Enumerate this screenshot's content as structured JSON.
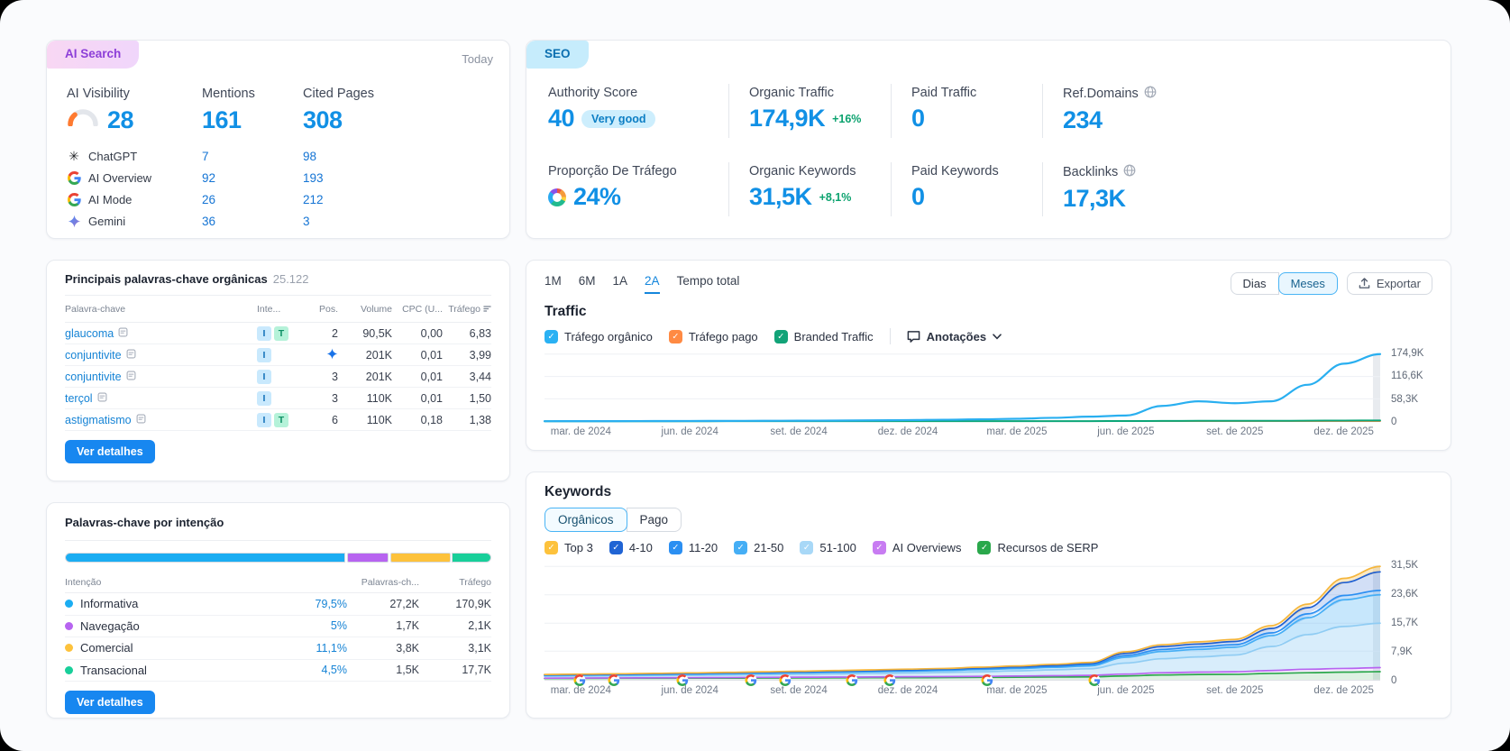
{
  "ai_search": {
    "tab": "AI Search",
    "date": "Today",
    "stats": [
      {
        "label": "AI Visibility",
        "value": "28"
      },
      {
        "label": "Mentions",
        "value": "161"
      },
      {
        "label": "Cited Pages",
        "value": "308"
      }
    ],
    "engines": [
      {
        "name": "ChatGPT",
        "icon": "chatgpt-icon",
        "mentions": "7",
        "cited": "98"
      },
      {
        "name": "AI Overview",
        "icon": "google-icon",
        "mentions": "92",
        "cited": "193"
      },
      {
        "name": "AI Mode",
        "icon": "google-icon",
        "mentions": "26",
        "cited": "212"
      },
      {
        "name": "Gemini",
        "icon": "gemini-icon",
        "mentions": "36",
        "cited": "3"
      }
    ]
  },
  "seo": {
    "tab": "SEO",
    "cells": [
      {
        "label": "Authority Score",
        "value": "40",
        "badge": "Very good"
      },
      {
        "label": "Organic Traffic",
        "value": "174,9K",
        "delta": "+16%"
      },
      {
        "label": "Paid Traffic",
        "value": "0"
      },
      {
        "label": "Ref.Domains",
        "value": "234",
        "icon": "globe-icon"
      },
      {
        "label": "Proporção De Tráfego",
        "value": "24%",
        "icon": "donut-icon"
      },
      {
        "label": "Organic Keywords",
        "value": "31,5K",
        "delta": "+8,1%"
      },
      {
        "label": "Paid Keywords",
        "value": "0"
      },
      {
        "label": "Backlinks",
        "value": "17,3K",
        "icon": "globe-icon"
      }
    ]
  },
  "top_keywords": {
    "title": "Principais palavras-chave orgânicas",
    "count": "25.122",
    "columns": [
      "Palavra-chave",
      "Inte...",
      "Pos.",
      "Volume",
      "CPC (U...",
      "Tráfego"
    ],
    "rows": [
      {
        "keyword": "glaucoma",
        "intents": [
          "I",
          "T"
        ],
        "pos": "2",
        "pos_is_icon": false,
        "volume": "90,5K",
        "cpc": "0,00",
        "traffic": "6,83"
      },
      {
        "keyword": "conjuntivite",
        "intents": [
          "I"
        ],
        "pos": "AI",
        "pos_is_icon": true,
        "volume": "201K",
        "cpc": "0,01",
        "traffic": "3,99"
      },
      {
        "keyword": "conjuntivite",
        "intents": [
          "I"
        ],
        "pos": "3",
        "pos_is_icon": false,
        "volume": "201K",
        "cpc": "0,01",
        "traffic": "3,44"
      },
      {
        "keyword": "terçol",
        "intents": [
          "I"
        ],
        "pos": "3",
        "pos_is_icon": false,
        "volume": "110K",
        "cpc": "0,01",
        "traffic": "1,50"
      },
      {
        "keyword": "astigmatismo",
        "intents": [
          "I",
          "T"
        ],
        "pos": "6",
        "pos_is_icon": false,
        "volume": "110K",
        "cpc": "0,18",
        "traffic": "1,38"
      }
    ],
    "button": "Ver detalhes"
  },
  "intent": {
    "title": "Palavras-chave por intenção",
    "columns": [
      "Intenção",
      "Palavras-ch...",
      "Tráfego"
    ],
    "rows": [
      {
        "label": "Informativa",
        "color": "#1badf2",
        "percent": "79,5%",
        "pct": 79.5,
        "keywords": "27,2K",
        "traffic": "170,9K"
      },
      {
        "label": "Navegação",
        "color": "#b764f0",
        "percent": "5%",
        "pct": 5,
        "keywords": "1,7K",
        "traffic": "2,1K"
      },
      {
        "label": "Comercial",
        "color": "#fdc23c",
        "percent": "11,1%",
        "pct": 11.1,
        "keywords": "3,8K",
        "traffic": "3,1K"
      },
      {
        "label": "Transacional",
        "color": "#18cf9a",
        "percent": "4,5%",
        "pct": 4.5,
        "keywords": "1,5K",
        "traffic": "17,7K"
      }
    ],
    "button": "Ver detalhes"
  },
  "traffic_panel": {
    "ranges": [
      "1M",
      "6M",
      "1A",
      "2A",
      "Tempo total"
    ],
    "active_range": "2A",
    "views": [
      "Dias",
      "Meses"
    ],
    "active_view": "Meses",
    "export_label": "Exportar",
    "title": "Traffic",
    "legend": [
      {
        "label": "Tráfego orgânico",
        "color": "#2ab1f3"
      },
      {
        "label": "Tráfego pago",
        "color": "#ff8a43"
      },
      {
        "label": "Branded Traffic",
        "color": "#12a378"
      }
    ],
    "annotations_label": "Anotações"
  },
  "keywords_panel": {
    "title": "Keywords",
    "tabs": [
      "Orgânicos",
      "Pago"
    ],
    "active_tab": "Orgânicos",
    "legend": [
      {
        "label": "Top 3",
        "color": "#fdc23c"
      },
      {
        "label": "4-10",
        "color": "#2064d4"
      },
      {
        "label": "11-20",
        "color": "#2b8ff2"
      },
      {
        "label": "21-50",
        "color": "#45aef5"
      },
      {
        "label": "51-100",
        "color": "#a8d8f7"
      },
      {
        "label": "AI Overviews",
        "color": "#c87cf2"
      },
      {
        "label": "Recursos de SERP",
        "color": "#2aa84b"
      }
    ]
  },
  "chart_data": [
    {
      "id": "traffic",
      "type": "line",
      "title": "Traffic",
      "ylim": [
        0,
        174.9
      ],
      "grid_values": [
        58.3,
        116.6,
        174.9
      ],
      "y_ticks": [
        {
          "label": "174,9K",
          "value": 174.9
        },
        {
          "label": "116,6K",
          "value": 116.6
        },
        {
          "label": "58,3K",
          "value": 58.3
        },
        {
          "label": "0",
          "value": 0
        }
      ],
      "x_ticks": [
        "mar. de 2024",
        "jun. de 2024",
        "set. de 2024",
        "dez. de 2024",
        "mar. de 2025",
        "jun. de 2025",
        "set. de 2025",
        "dez. de 2025"
      ],
      "series": [
        {
          "name": "Tráfego pago",
          "color": "#ff8a43",
          "width": 1.6,
          "values": [
            0,
            0,
            0,
            0,
            0,
            0,
            0,
            0,
            0,
            0,
            0,
            0,
            0,
            0,
            0,
            0,
            0,
            0,
            0,
            0,
            0,
            0,
            0,
            0
          ]
        },
        {
          "name": "Branded Traffic",
          "color": "#0ca678",
          "width": 2,
          "values": [
            0.05,
            0.05,
            0.06,
            0.07,
            0.08,
            0.09,
            0.1,
            0.12,
            0.14,
            0.16,
            0.18,
            0.2,
            0.25,
            0.3,
            0.35,
            0.4,
            0.5,
            0.8,
            1,
            1,
            1.1,
            1.4,
            1.8,
            2.2
          ]
        },
        {
          "name": "Tráfego orgânico",
          "color": "#29aff0",
          "width": 2.2,
          "values": [
            0.2,
            0.3,
            0.4,
            0.5,
            0.7,
            0.9,
            1.1,
            1.4,
            1.8,
            2.3,
            3,
            4,
            5,
            6.5,
            9,
            12,
            15,
            40,
            52,
            47,
            52,
            95,
            150,
            174.9
          ]
        }
      ]
    },
    {
      "id": "keywords",
      "type": "area-stacked",
      "title": "Keywords",
      "ylim": [
        0,
        31.5
      ],
      "grid_values": [
        7.9,
        15.7,
        23.6,
        31.5
      ],
      "y_ticks": [
        {
          "label": "31,5K",
          "value": 31.5
        },
        {
          "label": "23,6K",
          "value": 23.6
        },
        {
          "label": "15,7K",
          "value": 15.7
        },
        {
          "label": "7,9K",
          "value": 7.9
        },
        {
          "label": "0",
          "value": 0
        }
      ],
      "x_ticks": [
        "mar. de 2024",
        "jun. de 2024",
        "set. de 2024",
        "dez. de 2024",
        "mar. de 2025",
        "jun. de 2025",
        "set. de 2025",
        "dez. de 2025"
      ],
      "bands": [
        {
          "name": "Recursos de SERP",
          "color": "#2ca84c",
          "fill": "rgba(52,168,83,0.16)",
          "cumulative": [
            0.3,
            0.32,
            0.34,
            0.36,
            0.38,
            0.4,
            0.42,
            0.45,
            0.48,
            0.5,
            0.52,
            0.55,
            0.6,
            0.65,
            0.7,
            0.75,
            1,
            1.3,
            1.4,
            1.45,
            1.7,
            1.9,
            2.05,
            2.2
          ]
        },
        {
          "name": "AI Overviews",
          "color": "#b764f0",
          "fill": "rgba(183,100,240,0.12)",
          "cumulative": [
            0.4,
            0.43,
            0.46,
            0.49,
            0.52,
            0.56,
            0.6,
            0.64,
            0.68,
            0.72,
            0.76,
            0.8,
            0.88,
            0.96,
            1.05,
            1.15,
            1.5,
            1.9,
            2.05,
            2.15,
            2.5,
            2.85,
            3.1,
            3.3
          ]
        },
        {
          "name": "51-100",
          "color": "#8fccf3",
          "fill": "rgba(143,204,243,0.35)",
          "cumulative": [
            0.9,
            0.95,
            1,
            1.05,
            1.15,
            1.25,
            1.35,
            1.45,
            1.55,
            1.68,
            1.8,
            1.95,
            2.15,
            2.4,
            2.7,
            3,
            4.6,
            5.8,
            6.3,
            6.8,
            9.2,
            12.5,
            14.8,
            15.7
          ]
        },
        {
          "name": "21-50",
          "color": "#45aef5",
          "fill": "rgba(69,174,245,0.30)",
          "cumulative": [
            1.15,
            1.2,
            1.28,
            1.36,
            1.48,
            1.6,
            1.72,
            1.86,
            2,
            2.15,
            2.3,
            2.5,
            2.75,
            3.05,
            3.4,
            3.8,
            6.2,
            7.8,
            8.4,
            9,
            12.2,
            17.2,
            22.2,
            23.6
          ]
        },
        {
          "name": "11-20",
          "color": "#2b8ff2",
          "fill": "rgba(43,143,242,0.28)",
          "cumulative": [
            1.25,
            1.32,
            1.4,
            1.5,
            1.62,
            1.75,
            1.88,
            2.03,
            2.18,
            2.35,
            2.5,
            2.7,
            3,
            3.3,
            3.7,
            4.15,
            6.7,
            8.4,
            9.1,
            9.7,
            13,
            18.3,
            23.4,
            24.8
          ]
        },
        {
          "name": "4-10",
          "color": "#1f5fd0",
          "fill": "rgba(31,95,208,0.20)",
          "cumulative": [
            1.35,
            1.43,
            1.52,
            1.63,
            1.76,
            1.9,
            2.05,
            2.2,
            2.37,
            2.55,
            2.72,
            2.95,
            3.25,
            3.6,
            4,
            4.5,
            7.3,
            9.2,
            9.9,
            10.6,
            14.2,
            20,
            27,
            30
          ]
        },
        {
          "name": "Top 3",
          "color": "#f5b63c",
          "fill": "rgba(245,182,60,0.30)",
          "cumulative": [
            1.4,
            1.5,
            1.6,
            1.72,
            1.86,
            2,
            2.16,
            2.33,
            2.5,
            2.7,
            2.9,
            3.1,
            3.45,
            3.8,
            4.25,
            4.75,
            7.7,
            9.7,
            10.5,
            11.2,
            15,
            21,
            28.2,
            31.5
          ]
        }
      ],
      "markers": {
        "google_updates": [
          0.042,
          0.083,
          0.165,
          0.247,
          0.288,
          0.368,
          0.413,
          0.53,
          0.658
        ],
        "flag": 0.205
      }
    }
  ]
}
